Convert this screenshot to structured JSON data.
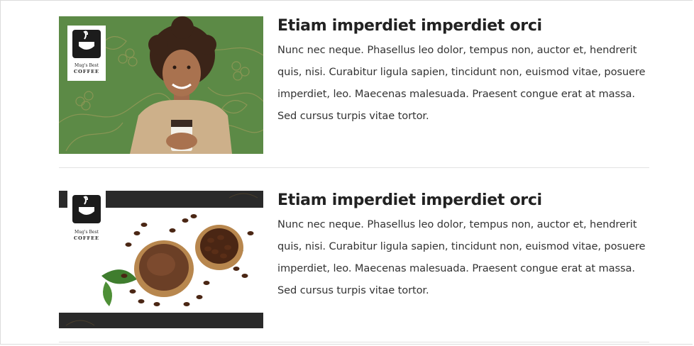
{
  "articles": [
    {
      "title": "Etiam imperdiet imperdiet orci",
      "body": "Nunc nec neque. Phasellus leo dolor, tempus non, auctor et, hendrerit quis, nisi. Curabitur ligula sapien, tincidunt non, euismod vitae, posuere imperdiet, leo. Maecenas malesuada. Praesent congue erat at massa. Sed cursus turpis vitae tortor.",
      "image": {
        "logo_line1": "Mug's Best",
        "logo_line2": "COFFEE",
        "bg_color": "#5c8a46"
      }
    },
    {
      "title": "Etiam imperdiet imperdiet orci",
      "body": "Nunc nec neque. Phasellus leo dolor, tempus non, auctor et, hendrerit quis, nisi. Curabitur ligula sapien, tincidunt non, euismod vitae, posuere imperdiet, leo. Maecenas malesuada. Praesent congue erat at massa. Sed cursus turpis vitae tortor.",
      "image": {
        "logo_line1": "Mug's Best",
        "logo_line2": "COFFEE",
        "bg_color": "#ffffff"
      }
    }
  ]
}
